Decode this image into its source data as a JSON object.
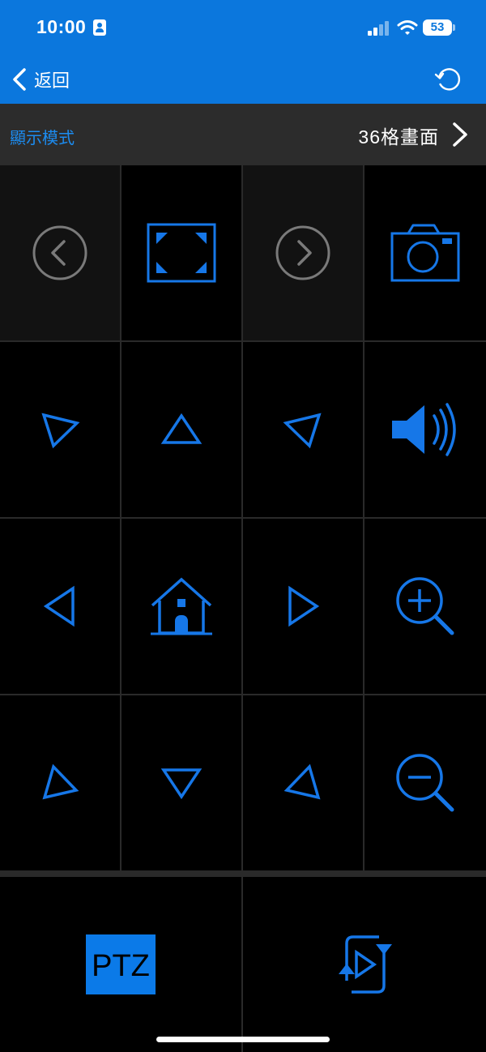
{
  "status_bar": {
    "time": "10:00",
    "battery": "53"
  },
  "nav": {
    "back_label": "返回"
  },
  "display_mode": {
    "label": "顯示模式",
    "value": "36格畫面"
  },
  "controls": {
    "ptz_label": "PTZ"
  },
  "colors": {
    "accent": "#0b77dd",
    "icon_blue": "#1677e8",
    "bar_gray": "#2c2c2c",
    "cell_dark": "#121212"
  },
  "icons": [
    "previous-circle-icon",
    "fullscreen-icon",
    "next-circle-icon",
    "camera-icon",
    "pan-up-left-icon",
    "pan-up-icon",
    "pan-up-right-icon",
    "speaker-icon",
    "pan-left-icon",
    "home-icon",
    "pan-right-icon",
    "zoom-in-icon",
    "pan-down-left-icon",
    "pan-down-icon",
    "pan-down-right-icon",
    "zoom-out-icon",
    "ptz-icon",
    "playback-cycle-icon"
  ]
}
